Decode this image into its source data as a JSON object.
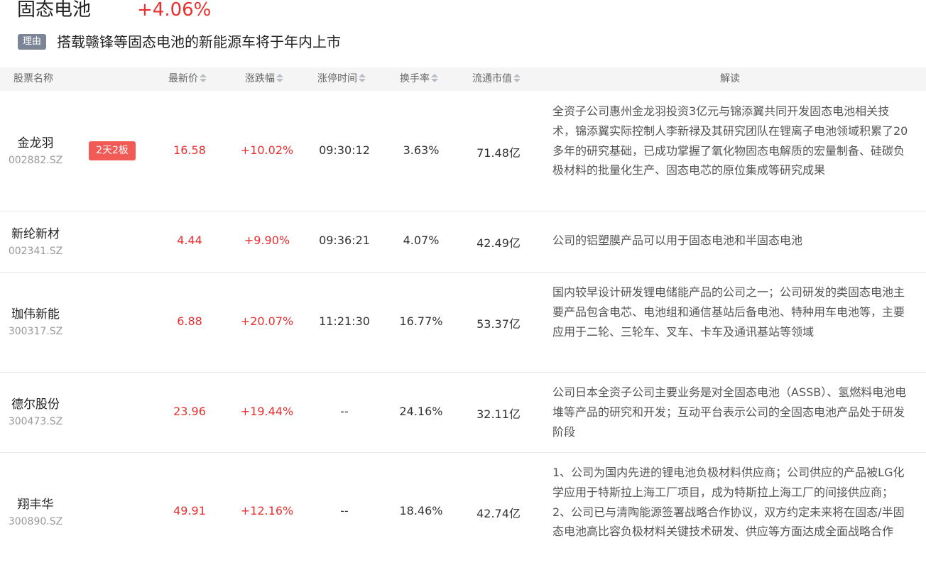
{
  "sector": {
    "name": "固态电池",
    "change": "+4.06%",
    "reason_tag": "理由",
    "reason_text": "搭载赣锋等固态电池的新能源车将于年内上市"
  },
  "columns": {
    "name": "股票名称",
    "price": "最新价",
    "change": "涨跌幅",
    "limit_time": "涨停时间",
    "turnover": "换手率",
    "float_cap": "流通市值",
    "comment": "解读"
  },
  "rows": [
    {
      "name": "金龙羽",
      "code": "002882.SZ",
      "badge": "2天2板",
      "price": "16.58",
      "change": "+10.02%",
      "limit_time": "09:30:12",
      "turnover": "3.63%",
      "float_cap": "71.48亿",
      "comment": "全资子公司惠州金龙羽投资3亿元与锦添翼共同开发固态电池相关技术，锦添翼实际控制人李新禄及其研究团队在锂离子电池领域积累了20多年的研究基础，已成功掌握了氧化物固态电解质的宏量制备、硅碳负极材料的批量化生产、固态电芯的原位集成等研究成果"
    },
    {
      "name": "新纶新材",
      "code": "002341.SZ",
      "badge": "",
      "price": "4.44",
      "change": "+9.90%",
      "limit_time": "09:36:21",
      "turnover": "4.07%",
      "float_cap": "42.49亿",
      "comment": "公司的铝塑膜产品可以用于固态电池和半固态电池"
    },
    {
      "name": "珈伟新能",
      "code": "300317.SZ",
      "badge": "",
      "price": "6.88",
      "change": "+20.07%",
      "limit_time": "11:21:30",
      "turnover": "16.77%",
      "float_cap": "53.37亿",
      "comment": "国内较早设计研发锂电储能产品的公司之一；公司研发的类固态电池主要产品包含电芯、电池组和通信基站后备电池、特种用车电池等，主要应用于二轮、三轮车、叉车、卡车及通讯基站等领域"
    },
    {
      "name": "德尔股份",
      "code": "300473.SZ",
      "badge": "",
      "price": "23.96",
      "change": "+19.44%",
      "limit_time": "--",
      "turnover": "24.16%",
      "float_cap": "32.11亿",
      "comment": "公司日本全资子公司主要业务是对全固态电池（ASSB）、氢燃料电池电堆等产品的研究和开发；互动平台表示公司的全固态电池产品处于研发阶段"
    },
    {
      "name": "翔丰华",
      "code": "300890.SZ",
      "badge": "",
      "price": "49.91",
      "change": "+12.16%",
      "limit_time": "--",
      "turnover": "18.46%",
      "float_cap": "42.74亿",
      "comment": "1、公司为国内先进的锂电池负极材料供应商；公司供应的产品被LG化学应用于特斯拉上海工厂项目，成为特斯拉上海工厂的间接供应商； 2、公司已与清陶能源签署战略合作协议，双方约定未来将在固态/半固态电池高比容负极材料关键技术研发、供应等方面达成全面战略合作"
    }
  ],
  "colors": {
    "up": "#e93030",
    "badge": "#f25a55",
    "tag": "#7c8596",
    "header_bg": "#f5f5f6"
  },
  "icons": {
    "sort": "sort-icon"
  }
}
